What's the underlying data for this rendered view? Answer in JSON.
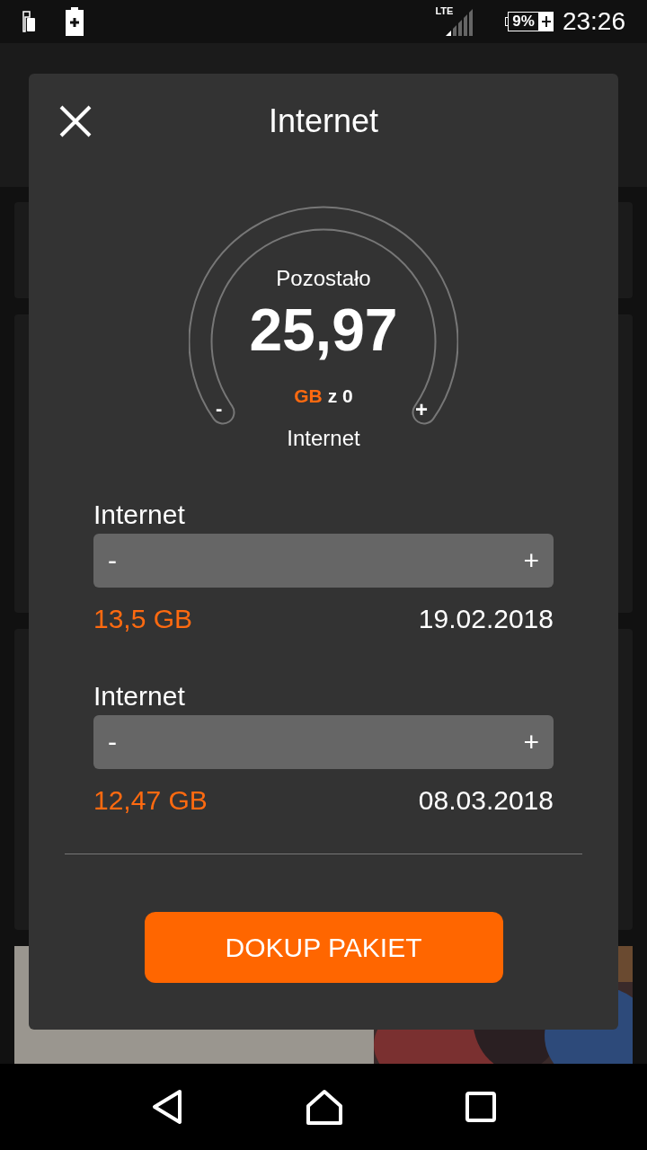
{
  "status_bar": {
    "network": "LTE",
    "battery": "9%",
    "time": "23:26"
  },
  "dialog": {
    "title": "Internet",
    "gauge": {
      "caption": "Pozostało",
      "value": "25,97",
      "unit": "GB",
      "of": "z 0",
      "minus": "-",
      "plus": "+",
      "label": "Internet"
    },
    "packages": [
      {
        "name": "Internet",
        "minus": "-",
        "plus": "+",
        "amount": "13,5 GB",
        "date": "19.02.2018"
      },
      {
        "name": "Internet",
        "minus": "-",
        "plus": "+",
        "amount": "12,47 GB",
        "date": "08.03.2018"
      }
    ],
    "button": "DOKUP PAKIET"
  }
}
